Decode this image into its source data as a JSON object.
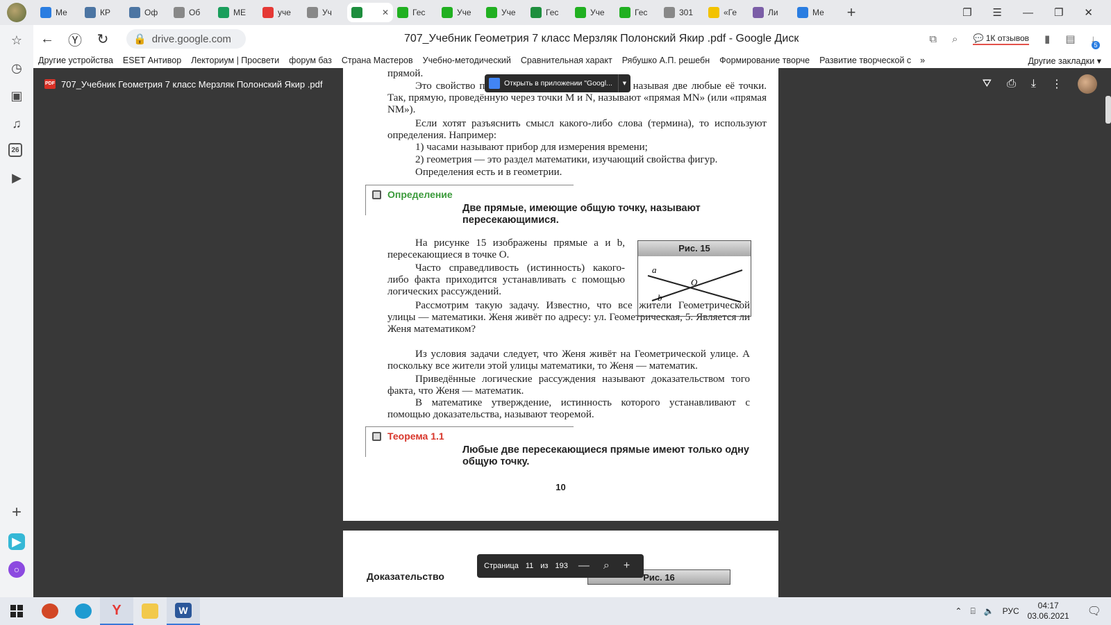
{
  "tabs": [
    {
      "label": "Ме",
      "color": "#2a7de1"
    },
    {
      "label": "КР",
      "color": "#4c75a3"
    },
    {
      "label": "Оф",
      "color": "#4c75a3"
    },
    {
      "label": "Об",
      "color": "#888888"
    },
    {
      "label": "МЕ",
      "color": "#1a9e5c"
    },
    {
      "label": "уче",
      "color": "#e53935"
    },
    {
      "label": "Уч",
      "color": "#888888"
    },
    {
      "label": "",
      "color": "#1e8e3e"
    },
    {
      "label": "Гес",
      "color": "#21b021"
    },
    {
      "label": "Уче",
      "color": "#21b021"
    },
    {
      "label": "Уче",
      "color": "#21b021"
    },
    {
      "label": "Гес",
      "color": "#1e8e3e"
    },
    {
      "label": "Уче",
      "color": "#21b021"
    },
    {
      "label": "Гес",
      "color": "#21b021"
    },
    {
      "label": "301",
      "color": "#888888"
    },
    {
      "label": "«Ге",
      "color": "#f2c200"
    },
    {
      "label": "Ли",
      "color": "#7b5ea7"
    },
    {
      "label": "Ме",
      "color": "#2a7de1"
    }
  ],
  "toolbar": {
    "url": "drive.google.com",
    "page_title": "707_Учебник Геометрия 7 класс Мерзляк Полонский Якир .pdf - Google Диск",
    "reviews": "1К отзывов",
    "downloads_badge": "5"
  },
  "bookmarks": [
    "Другие устройства",
    "ESET Антивор",
    "Лекториум | Просвети",
    "форум баз",
    "Страна Мастеров",
    "Учебно-методический",
    "Сравнительная характ",
    "Рябушко А.П. решебн",
    "Формирование творче",
    "Развитие творческой с"
  ],
  "bookmarks_more": "»",
  "bookmarks_other": "Другие закладки",
  "sidebar": {
    "calendar_day": "26"
  },
  "viewer": {
    "file_name": "707_Учебник Геометрия 7 класс Мерзляк Полонский Якир .pdf",
    "open_in_app": "Открыть в приложении \"Googl..."
  },
  "page1": {
    "p0": "прямой.",
    "p1": "Это свойство прямой позволяет обозначать её, называя две любые её точки. Так, прямую, проведённую через точки M и N, называют «прямая MN» (или «прямая NM»).",
    "p2": "Если хотят разъяснить смысл какого-либо слова (термина), то используют определения. Например:",
    "p3": "1) часами называют прибор для измерения времени;",
    "p4": "2) геометрия — это раздел математики, изучающий свойства фигур.",
    "p5": "Определения есть и в геометрии.",
    "def_label": "Определение",
    "def_text": "Две прямые, имеющие общую точку, называют пересекающимися.",
    "p6": "На рисунке 15 изображены прямые a и b, пересекающиеся в точке O.",
    "p7": "Часто справедливость (истинность) какого-либо факта приходится устанавливать с помощью логических рассуждений.",
    "p8": "Рассмотрим такую задачу. Известно, что все жители Геометрической улицы — математики. Женя живёт по адресу: ул. Геометрическая, 5. Является ли Женя математиком?",
    "p9": "Из условия задачи следует, что Женя живёт на Геометрической улице. А поскольку все жители этой улицы математики, то Женя — математик.",
    "p10": "Приведённые логические рассуждения называют доказательством того факта, что Женя — математик.",
    "p11": "В математике утверждение, истинность которого устанавливают с помощью доказательства, называют теоремой.",
    "thm_label": "Теорема 1.1",
    "thm_text": "Любые две пересекающиеся прямые имеют только одну общую точку.",
    "fig_caption": "Рис. 15",
    "fig_a": "a",
    "fig_b": "b",
    "fig_o": "O",
    "page_number": "10"
  },
  "page2": {
    "proof_label": "Доказательство",
    "fig_caption": "Рис. 16"
  },
  "pagenav": {
    "label": "Страница",
    "current": "11",
    "of": "из",
    "total": "193"
  },
  "taskbar": {
    "lang": "РУС",
    "time": "04:17",
    "date": "03.06.2021"
  }
}
